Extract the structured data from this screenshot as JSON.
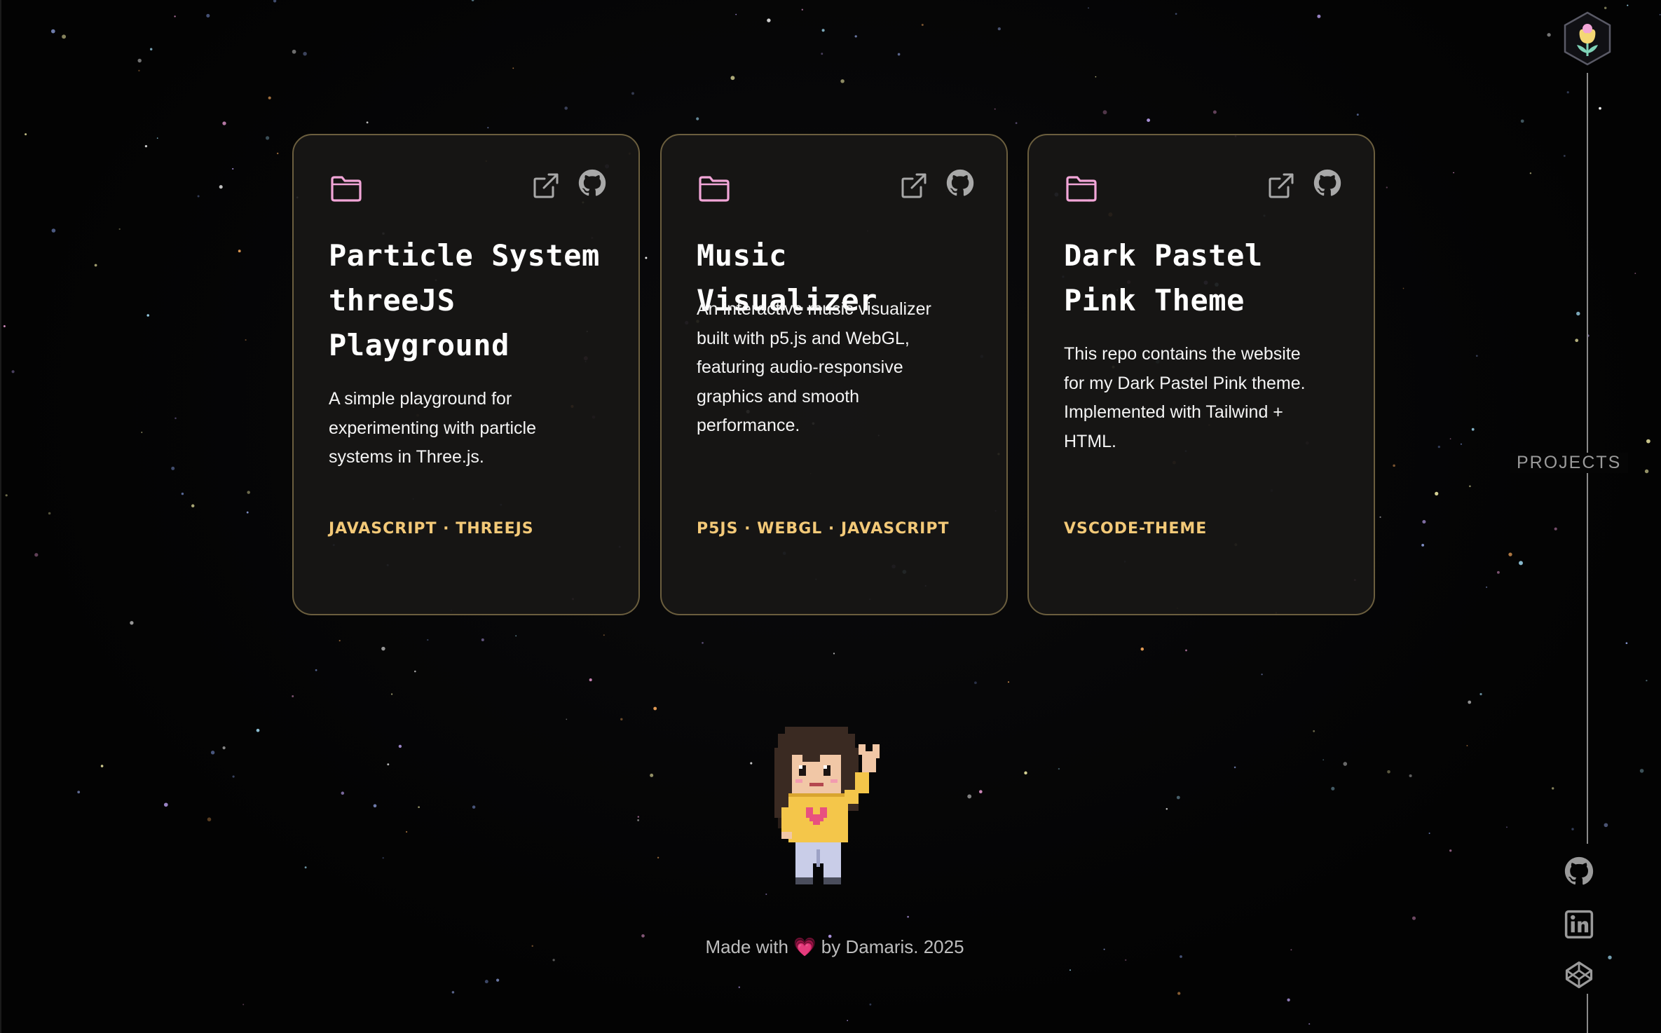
{
  "theme": {
    "background": "#050505",
    "card_background": "#181716",
    "card_border": "#6b5e3e",
    "tag_color": "#f3c978",
    "icon_pink": "#f2a6d8",
    "icon_gray": "#a8a8a8",
    "heart_color": "#ff4fa3"
  },
  "projects": [
    {
      "title": "Particle System threeJS Playground",
      "description": "A simple playground for experimenting with particle systems in Three.js.",
      "tags": "JAVASCRIPT · THREEJS",
      "icons": [
        "folder-icon",
        "external-link-icon",
        "github-icon"
      ]
    },
    {
      "title": "Music Visualizer",
      "description": "An interactive music visualizer built with p5.js and WebGL, featuring audio-responsive graphics and smooth performance.",
      "tags": "P5JS · WEBGL · JAVASCRIPT",
      "icons": [
        "folder-icon",
        "external-link-icon",
        "github-icon"
      ]
    },
    {
      "title": "Dark Pastel Pink Theme",
      "description": "This repo contains the website for my Dark Pastel Pink theme. Implemented with Tailwind + HTML.",
      "tags": "VSCODE-THEME",
      "icons": [
        "folder-icon",
        "external-link-icon",
        "github-icon"
      ]
    }
  ],
  "sidebar": {
    "logo_icon": "tulip-hexagon-logo-icon",
    "section_label": "PROJECTS",
    "socials": [
      "github-icon",
      "linkedin-icon",
      "codepen-icon"
    ]
  },
  "avatar": {
    "icon": "pixel-girl-waving-icon"
  },
  "footer": {
    "prefix": "Made with",
    "heart": "💗",
    "suffix": "by Damaris. 2025"
  }
}
